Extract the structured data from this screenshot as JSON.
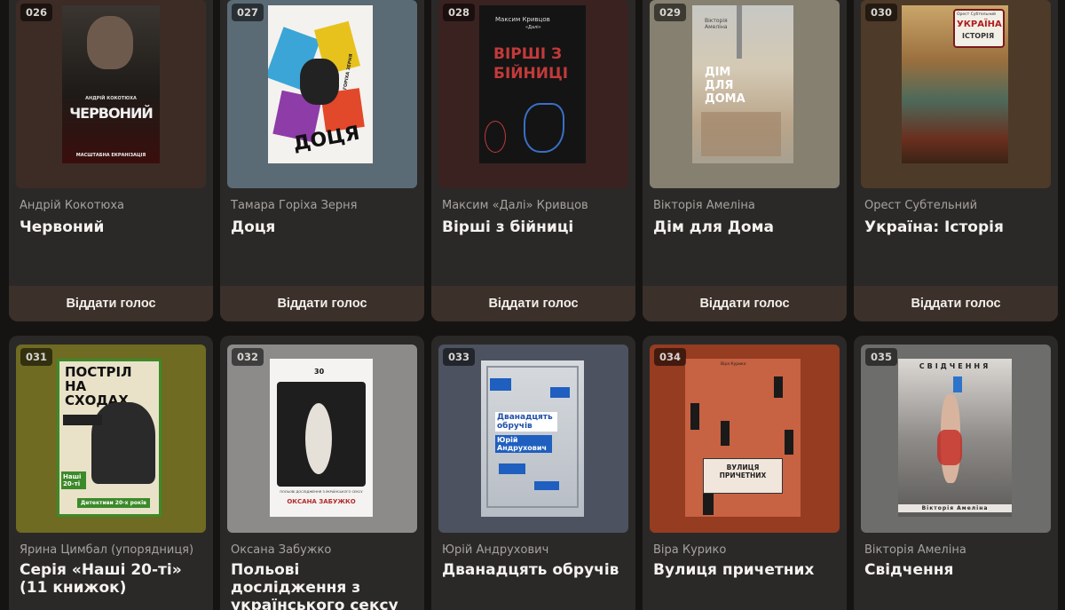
{
  "vote_label": "Віддати голос",
  "books": [
    {
      "num": "026",
      "author": "Андрій Кокотюха",
      "title": "Червоний",
      "cover_bg": "#3c2c25",
      "cover_lines": [
        "АНДРІЙ КОКОТЮХА",
        "ЧЕРВОНИЙ",
        "МАСШТАБНА ЕКРАНІЗАЦІЯ"
      ]
    },
    {
      "num": "027",
      "author": "Тамара Горіха Зерня",
      "title": "Доця",
      "cover_bg": "#5b6b76",
      "cover_lines": [
        "ДОЦЯ",
        "ГОРІХА ЗЕРНЯ"
      ]
    },
    {
      "num": "028",
      "author": "Максим «Далі» Кривцов",
      "title": "Вірші з бійниці",
      "cover_bg": "#3a2221",
      "cover_lines": [
        "Максим Кривцов",
        "«Далі»",
        "ВІРШІ З БІЙНИЦІ"
      ]
    },
    {
      "num": "029",
      "author": "Вікторія Амеліна",
      "title": "Дім для Дома",
      "cover_bg": "#858070",
      "cover_lines": [
        "Вікторія Амеліна",
        "ДІМ ДЛЯ ДОМА"
      ]
    },
    {
      "num": "030",
      "author": "Орест Субтельний",
      "title": "Україна: Історія",
      "cover_bg": "#4e3a28",
      "cover_lines": [
        "Орест Субтельний",
        "УКРАЇНА",
        "ІСТОРІЯ"
      ]
    },
    {
      "num": "031",
      "author": "Ярина Цимбал (упорядниця)",
      "title": "Серія «Наші 20-ті» (11 книжок)",
      "cover_bg": "#6f6b22",
      "cover_lines": [
        "ПОСТРІЛ НА СХОДАХ",
        "Наші 20-ті",
        "Детективи 20-х років"
      ]
    },
    {
      "num": "032",
      "author": "Оксана Забужко",
      "title": "Польові дослідження з українського сексу",
      "cover_bg": "#8d8b89",
      "cover_lines": [
        "30",
        "ПОЛЬОВІ ДОСЛІДЖЕННЯ З УКРАЇНСЬКОГО СЕКСУ",
        "ОКСАНА ЗАБУЖКО"
      ]
    },
    {
      "num": "033",
      "author": "Юрій Андрухович",
      "title": "Дванадцять обручів",
      "cover_bg": "#4d5260",
      "cover_lines": [
        "Дванадцять обручів",
        "Юрій Андрухович"
      ]
    },
    {
      "num": "034",
      "author": "Віра Курико",
      "title": "Вулиця причетних",
      "cover_bg": "#953c21",
      "cover_lines": [
        "ВУЛИЦЯ ПРИЧЕТНИХ",
        "Віра Курико"
      ]
    },
    {
      "num": "035",
      "author": "Вікторія Амеліна",
      "title": "Свідчення",
      "cover_bg": "#6d6d6c",
      "cover_lines": [
        "СВІДЧЕННЯ",
        "Вікторія Амеліна"
      ]
    }
  ]
}
